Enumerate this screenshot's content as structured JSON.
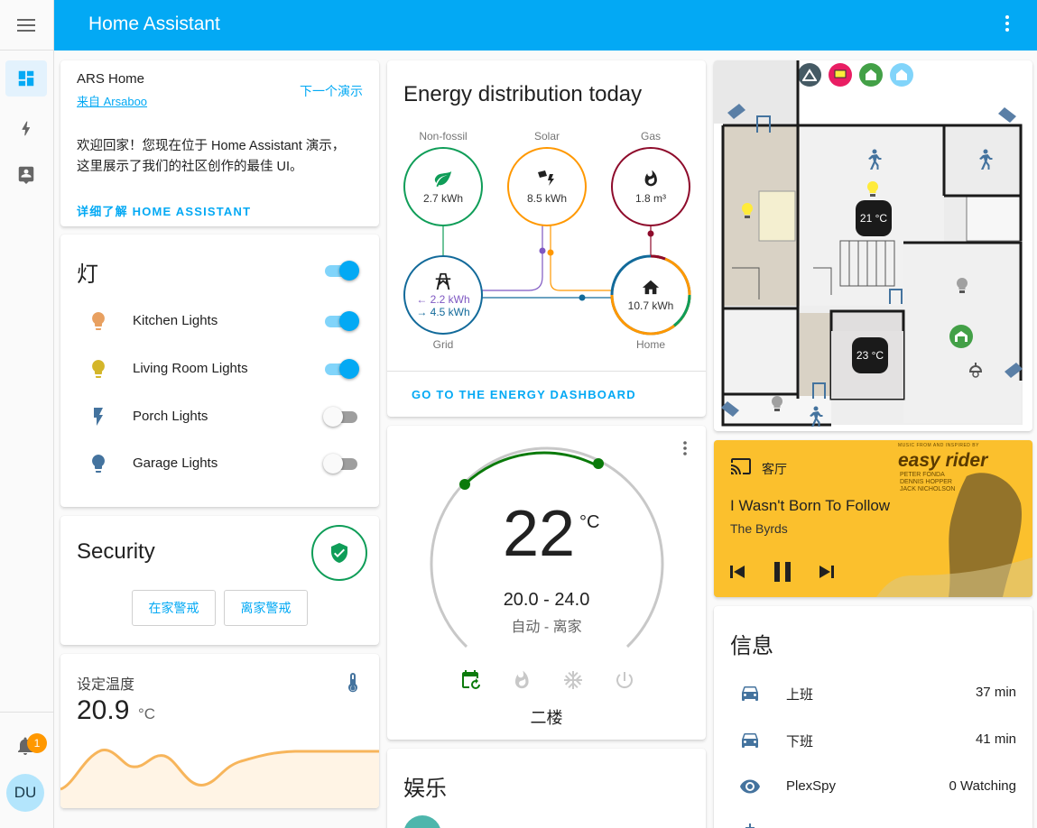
{
  "header": {
    "title": "Home Assistant"
  },
  "sidebar": {
    "avatar_initials": "DU",
    "notification_count": "1"
  },
  "welcome": {
    "title": "ARS Home",
    "subtitle": "来自 Arsaboo",
    "next_demo": "下一个演示",
    "body_line1": "欢迎回家！您现在位于 Home Assistant 演示，",
    "body_line2": "这里展示了我们的社区创作的最佳 UI。",
    "learn_more": "详细了解 HOME ASSISTANT"
  },
  "lights": {
    "title": "灯",
    "items": [
      {
        "name": "Kitchen Lights",
        "on": true,
        "color": "#e8a060"
      },
      {
        "name": "Living Room Lights",
        "on": true,
        "color": "#d4b62a"
      },
      {
        "name": "Porch Lights",
        "on": false,
        "color": "#44739e"
      },
      {
        "name": "Garage Lights",
        "on": false,
        "color": "#44739e"
      }
    ]
  },
  "security": {
    "title": "Security",
    "arm_home": "在家警戒",
    "arm_away": "离家警戒"
  },
  "setpoint": {
    "title": "设定温度",
    "value": "20.9",
    "unit": "°C"
  },
  "energy": {
    "title": "Energy distribution today",
    "nonfossil_label": "Non-fossil",
    "nonfossil_value": "2.7 kWh",
    "solar_label": "Solar",
    "solar_value": "8.5 kWh",
    "gas_label": "Gas",
    "gas_value": "1.8 m³",
    "grid_label": "Grid",
    "grid_in": "← 2.2 kWh",
    "grid_out": "→ 4.5 kWh",
    "home_label": "Home",
    "home_value": "10.7 kWh",
    "link": "GO TO THE ENERGY DASHBOARD"
  },
  "thermostat": {
    "temperature": "22",
    "unit": "°C",
    "range": "20.0 - 24.0",
    "mode": "自动 - 离家",
    "name": "二楼"
  },
  "entertainment": {
    "title": "娱乐"
  },
  "floorplan": {
    "temp1": "21 °C",
    "temp2": "23 °C"
  },
  "media": {
    "room": "客厅",
    "track": "I Wasn't Born To Follow",
    "artist": "The Byrds",
    "album_title": "easy rider",
    "album_credit_top": "MUSIC FROM AND INSPIRED BY",
    "album_credit_1": "PETER FONDA",
    "album_credit_2": "DENNIS HOPPER",
    "album_credit_3": "JACK NICHOLSON"
  },
  "info": {
    "title": "信息",
    "items": [
      {
        "name": "上班",
        "value": "37 min"
      },
      {
        "name": "下班",
        "value": "41 min"
      },
      {
        "name": "PlexSpy",
        "value": "0 Watching"
      }
    ]
  },
  "colors": {
    "primary": "#03a9f4",
    "accent": "#ff9800",
    "energy_green": "#0f9d58",
    "solar": "#ff9800",
    "gas": "#8e0b2b",
    "grid": "#126a9a"
  }
}
